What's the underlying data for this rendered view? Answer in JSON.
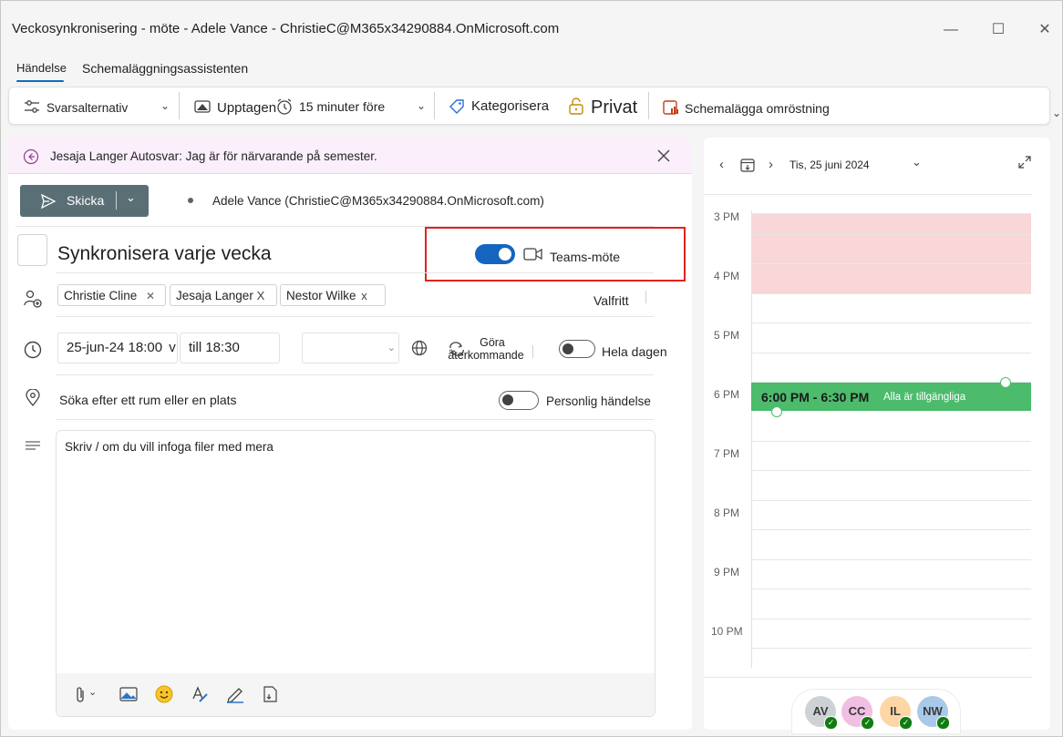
{
  "window": {
    "title": "Veckosynkronisering - möte - Adele Vance - ChristieC@M365x34290884.OnMicrosoft.com",
    "minimize": "—",
    "maximize": "☐",
    "close": "✕"
  },
  "tabs": [
    {
      "label": "Händelse"
    },
    {
      "label": "Schemaläggningsassistenten"
    }
  ],
  "ribbon": {
    "response_options": "Svarsalternativ",
    "busy": "Upptagen",
    "reminder": "15 minuter före",
    "categorize": "Kategorisera",
    "private": "Privat",
    "schedule_poll": "Schemalägga omröstning"
  },
  "banner": {
    "text": "Jesaja Langer Autosvar: Jag är för närvarande på semester."
  },
  "send": {
    "label": "Skicka",
    "organizer": "Adele Vance (ChristieC@M365x34290884.OnMicrosoft.com)"
  },
  "event": {
    "title": "Synkronisera varje vecka",
    "teams_label": "Teams-möte",
    "attendees": [
      {
        "name": "Christie Cline",
        "remove": "✕"
      },
      {
        "name": "Jesaja Langer",
        "remove": "X"
      },
      {
        "name": "Nestor Wilke",
        "remove": "x"
      }
    ],
    "optional": "Valfritt",
    "start": "25-jun-24 18:00",
    "start_suffix": "v",
    "end": "till 18:30",
    "recurring_line1": "Göra",
    "recurring_line2": "återkommande",
    "all_day": "Hela dagen",
    "location_placeholder": "Söka efter ett rum eller en plats",
    "personal_event": "Personlig händelse",
    "body_placeholder": "Skriv / om du vill infoga filer med mera"
  },
  "calendar": {
    "date": "Tis, 25 juni 2024",
    "hours": [
      "3 PM",
      "4 PM",
      "5 PM",
      "6 PM",
      "7 PM",
      "8 PM",
      "9 PM",
      "10 PM"
    ],
    "event_time": "6:00 PM - 6:30 PM",
    "event_status": "Alla är tillgängliga",
    "avatars": [
      {
        "initials": "AV",
        "color": "#cfd2d4"
      },
      {
        "initials": "CC",
        "color": "#f1bfe3"
      },
      {
        "initials": "IL",
        "color": "#fcd6a5"
      },
      {
        "initials": "NW",
        "color": "#a9c9e8"
      }
    ]
  },
  "colors": {
    "accent": "#0f6cbd",
    "busy_block": "#f9d6d8",
    "event_green": "#4cbb6c",
    "highlight_red": "#e1231f"
  }
}
